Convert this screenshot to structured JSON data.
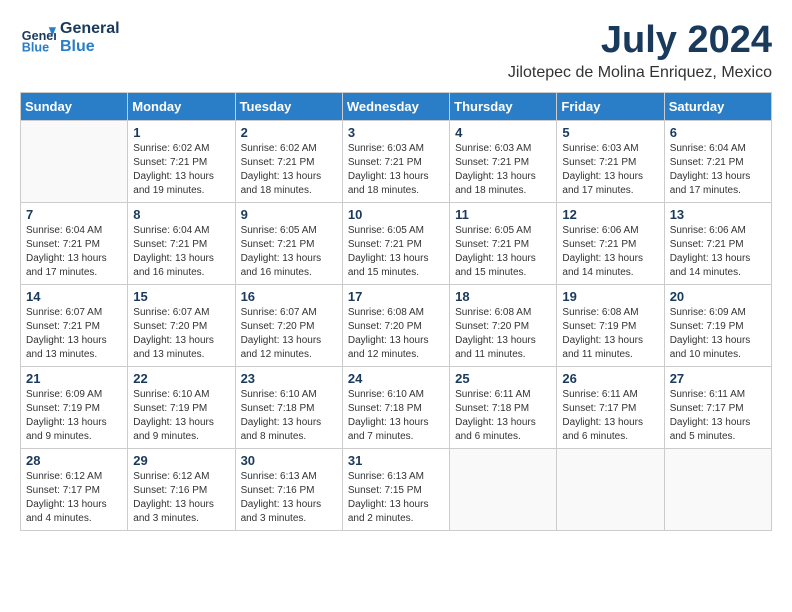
{
  "header": {
    "logo_line1": "General",
    "logo_line2": "Blue",
    "month": "July 2024",
    "location": "Jilotepec de Molina Enriquez, Mexico"
  },
  "weekdays": [
    "Sunday",
    "Monday",
    "Tuesday",
    "Wednesday",
    "Thursday",
    "Friday",
    "Saturday"
  ],
  "weeks": [
    [
      {
        "day": "",
        "sunrise": "",
        "sunset": "",
        "daylight": ""
      },
      {
        "day": "1",
        "sunrise": "Sunrise: 6:02 AM",
        "sunset": "Sunset: 7:21 PM",
        "daylight": "Daylight: 13 hours and 19 minutes."
      },
      {
        "day": "2",
        "sunrise": "Sunrise: 6:02 AM",
        "sunset": "Sunset: 7:21 PM",
        "daylight": "Daylight: 13 hours and 18 minutes."
      },
      {
        "day": "3",
        "sunrise": "Sunrise: 6:03 AM",
        "sunset": "Sunset: 7:21 PM",
        "daylight": "Daylight: 13 hours and 18 minutes."
      },
      {
        "day": "4",
        "sunrise": "Sunrise: 6:03 AM",
        "sunset": "Sunset: 7:21 PM",
        "daylight": "Daylight: 13 hours and 18 minutes."
      },
      {
        "day": "5",
        "sunrise": "Sunrise: 6:03 AM",
        "sunset": "Sunset: 7:21 PM",
        "daylight": "Daylight: 13 hours and 17 minutes."
      },
      {
        "day": "6",
        "sunrise": "Sunrise: 6:04 AM",
        "sunset": "Sunset: 7:21 PM",
        "daylight": "Daylight: 13 hours and 17 minutes."
      }
    ],
    [
      {
        "day": "7",
        "sunrise": "Sunrise: 6:04 AM",
        "sunset": "Sunset: 7:21 PM",
        "daylight": "Daylight: 13 hours and 17 minutes."
      },
      {
        "day": "8",
        "sunrise": "Sunrise: 6:04 AM",
        "sunset": "Sunset: 7:21 PM",
        "daylight": "Daylight: 13 hours and 16 minutes."
      },
      {
        "day": "9",
        "sunrise": "Sunrise: 6:05 AM",
        "sunset": "Sunset: 7:21 PM",
        "daylight": "Daylight: 13 hours and 16 minutes."
      },
      {
        "day": "10",
        "sunrise": "Sunrise: 6:05 AM",
        "sunset": "Sunset: 7:21 PM",
        "daylight": "Daylight: 13 hours and 15 minutes."
      },
      {
        "day": "11",
        "sunrise": "Sunrise: 6:05 AM",
        "sunset": "Sunset: 7:21 PM",
        "daylight": "Daylight: 13 hours and 15 minutes."
      },
      {
        "day": "12",
        "sunrise": "Sunrise: 6:06 AM",
        "sunset": "Sunset: 7:21 PM",
        "daylight": "Daylight: 13 hours and 14 minutes."
      },
      {
        "day": "13",
        "sunrise": "Sunrise: 6:06 AM",
        "sunset": "Sunset: 7:21 PM",
        "daylight": "Daylight: 13 hours and 14 minutes."
      }
    ],
    [
      {
        "day": "14",
        "sunrise": "Sunrise: 6:07 AM",
        "sunset": "Sunset: 7:21 PM",
        "daylight": "Daylight: 13 hours and 13 minutes."
      },
      {
        "day": "15",
        "sunrise": "Sunrise: 6:07 AM",
        "sunset": "Sunset: 7:20 PM",
        "daylight": "Daylight: 13 hours and 13 minutes."
      },
      {
        "day": "16",
        "sunrise": "Sunrise: 6:07 AM",
        "sunset": "Sunset: 7:20 PM",
        "daylight": "Daylight: 13 hours and 12 minutes."
      },
      {
        "day": "17",
        "sunrise": "Sunrise: 6:08 AM",
        "sunset": "Sunset: 7:20 PM",
        "daylight": "Daylight: 13 hours and 12 minutes."
      },
      {
        "day": "18",
        "sunrise": "Sunrise: 6:08 AM",
        "sunset": "Sunset: 7:20 PM",
        "daylight": "Daylight: 13 hours and 11 minutes."
      },
      {
        "day": "19",
        "sunrise": "Sunrise: 6:08 AM",
        "sunset": "Sunset: 7:19 PM",
        "daylight": "Daylight: 13 hours and 11 minutes."
      },
      {
        "day": "20",
        "sunrise": "Sunrise: 6:09 AM",
        "sunset": "Sunset: 7:19 PM",
        "daylight": "Daylight: 13 hours and 10 minutes."
      }
    ],
    [
      {
        "day": "21",
        "sunrise": "Sunrise: 6:09 AM",
        "sunset": "Sunset: 7:19 PM",
        "daylight": "Daylight: 13 hours and 9 minutes."
      },
      {
        "day": "22",
        "sunrise": "Sunrise: 6:10 AM",
        "sunset": "Sunset: 7:19 PM",
        "daylight": "Daylight: 13 hours and 9 minutes."
      },
      {
        "day": "23",
        "sunrise": "Sunrise: 6:10 AM",
        "sunset": "Sunset: 7:18 PM",
        "daylight": "Daylight: 13 hours and 8 minutes."
      },
      {
        "day": "24",
        "sunrise": "Sunrise: 6:10 AM",
        "sunset": "Sunset: 7:18 PM",
        "daylight": "Daylight: 13 hours and 7 minutes."
      },
      {
        "day": "25",
        "sunrise": "Sunrise: 6:11 AM",
        "sunset": "Sunset: 7:18 PM",
        "daylight": "Daylight: 13 hours and 6 minutes."
      },
      {
        "day": "26",
        "sunrise": "Sunrise: 6:11 AM",
        "sunset": "Sunset: 7:17 PM",
        "daylight": "Daylight: 13 hours and 6 minutes."
      },
      {
        "day": "27",
        "sunrise": "Sunrise: 6:11 AM",
        "sunset": "Sunset: 7:17 PM",
        "daylight": "Daylight: 13 hours and 5 minutes."
      }
    ],
    [
      {
        "day": "28",
        "sunrise": "Sunrise: 6:12 AM",
        "sunset": "Sunset: 7:17 PM",
        "daylight": "Daylight: 13 hours and 4 minutes."
      },
      {
        "day": "29",
        "sunrise": "Sunrise: 6:12 AM",
        "sunset": "Sunset: 7:16 PM",
        "daylight": "Daylight: 13 hours and 3 minutes."
      },
      {
        "day": "30",
        "sunrise": "Sunrise: 6:13 AM",
        "sunset": "Sunset: 7:16 PM",
        "daylight": "Daylight: 13 hours and 3 minutes."
      },
      {
        "day": "31",
        "sunrise": "Sunrise: 6:13 AM",
        "sunset": "Sunset: 7:15 PM",
        "daylight": "Daylight: 13 hours and 2 minutes."
      },
      {
        "day": "",
        "sunrise": "",
        "sunset": "",
        "daylight": ""
      },
      {
        "day": "",
        "sunrise": "",
        "sunset": "",
        "daylight": ""
      },
      {
        "day": "",
        "sunrise": "",
        "sunset": "",
        "daylight": ""
      }
    ]
  ]
}
